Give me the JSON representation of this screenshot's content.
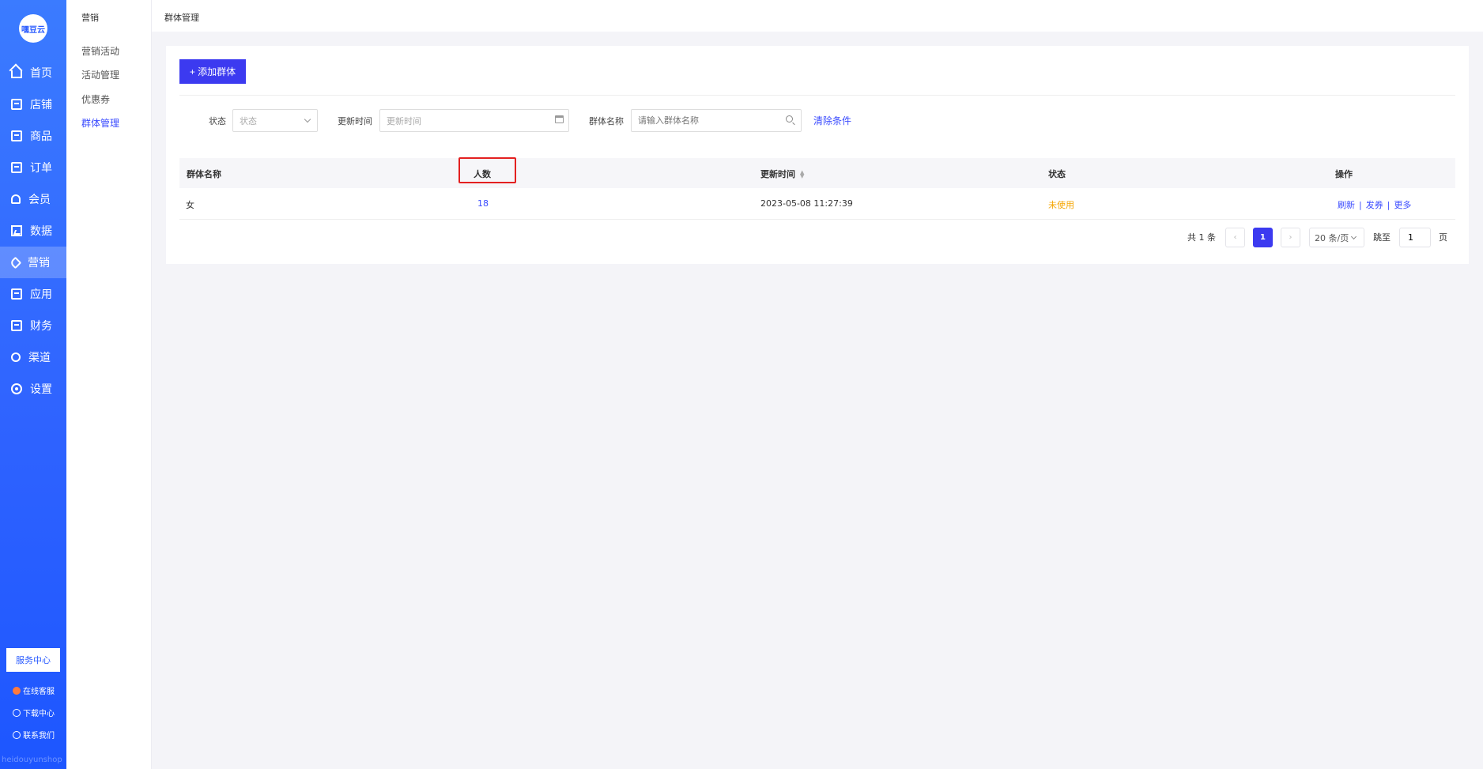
{
  "logo": {
    "text": "嘿豆云"
  },
  "nav": {
    "items": [
      {
        "label": "首页",
        "icon": "home-icon"
      },
      {
        "label": "店铺",
        "icon": "store-icon"
      },
      {
        "label": "商品",
        "icon": "goods-icon"
      },
      {
        "label": "订单",
        "icon": "order-icon"
      },
      {
        "label": "会员",
        "icon": "member-icon"
      },
      {
        "label": "数据",
        "icon": "data-chart-icon"
      },
      {
        "label": "营销",
        "icon": "tag-icon",
        "active": true
      },
      {
        "label": "应用",
        "icon": "app-icon"
      },
      {
        "label": "财务",
        "icon": "finance-icon"
      },
      {
        "label": "渠道",
        "icon": "channel-icon"
      },
      {
        "label": "设置",
        "icon": "gear-icon"
      }
    ],
    "service_center": "服务中心",
    "footer": [
      {
        "label": "在线客服",
        "icon": "customer-service-icon"
      },
      {
        "label": "下载中心",
        "icon": "download-icon"
      },
      {
        "label": "联系我们",
        "icon": "contact-icon"
      }
    ],
    "brand_text": "heidouyunshop"
  },
  "subnav": {
    "title": "营销",
    "items": [
      {
        "label": "营销活动"
      },
      {
        "label": "活动管理"
      },
      {
        "label": "优惠券"
      },
      {
        "label": "群体管理",
        "active": true
      }
    ]
  },
  "header": {
    "title": "群体管理"
  },
  "toolbar": {
    "add_label": "+ 添加群体"
  },
  "filters": {
    "status_label": "状态",
    "status_placeholder": "状态",
    "time_label": "更新时间",
    "time_placeholder": "更新时间",
    "name_label": "群体名称",
    "name_placeholder": "请输入群体名称",
    "clear_label": "清除条件"
  },
  "table": {
    "columns": [
      "群体名称",
      "人数",
      "更新时间",
      "状态",
      "操作"
    ],
    "rows": [
      {
        "name": "女",
        "count": "18",
        "updated": "2023-05-08 11:27:39",
        "status": "未使用",
        "actions": [
          "刷新",
          "发券",
          "更多"
        ]
      }
    ]
  },
  "pagination": {
    "total": "共 1 条",
    "current": "1",
    "page_size": "20 条/页",
    "jump_label": "跳至",
    "jump_value": "1",
    "page_unit": "页"
  },
  "colors": {
    "primary": "#3c3af0",
    "link": "#3a4bff",
    "warn": "#f5a500",
    "highlight": "#e32020"
  }
}
